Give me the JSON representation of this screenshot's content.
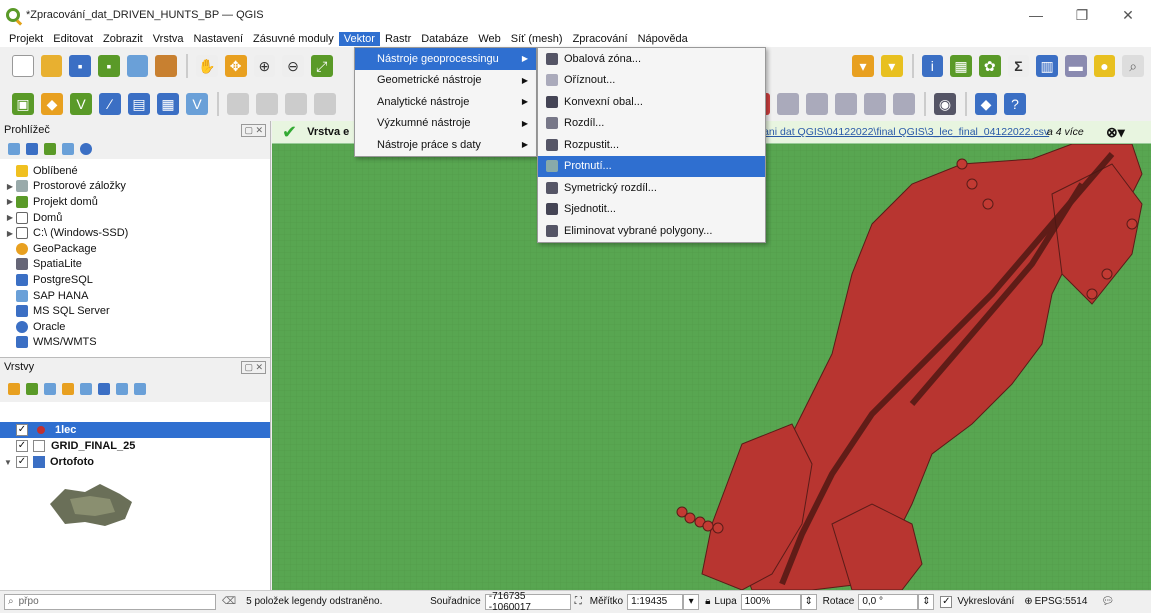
{
  "window": {
    "title": "*Zpracování_dat_DRIVEN_HUNTS_BP — QGIS"
  },
  "menubar": {
    "items": [
      "Projekt",
      "Editovat",
      "Zobrazit",
      "Vrstva",
      "Nastavení",
      "Zásuvné moduly",
      "Vektor",
      "Rastr",
      "Databáze",
      "Web",
      "Síť (mesh)",
      "Zpracování",
      "Nápověda"
    ],
    "active": "Vektor"
  },
  "vector_menu": {
    "items": [
      "Nástroje geoprocessingu",
      "Geometrické nástroje",
      "Analytické nástroje",
      "Výzkumné nástroje",
      "Nástroje práce s daty"
    ],
    "highlighted": "Nástroje geoprocessingu"
  },
  "geoprocessing_menu": {
    "items": [
      "Obalová zóna...",
      "Oříznout...",
      "Konvexní obal...",
      "Rozdíl...",
      "Rozpustit...",
      "Protnutí...",
      "Symetrický rozdíl...",
      "Sjednotit...",
      "Eliminovat vybrané polygony..."
    ],
    "highlighted": "Protnutí..."
  },
  "browser": {
    "title": "Prohlížeč",
    "items": [
      "Oblíbené",
      "Prostorové záložky",
      "Projekt domů",
      "Domů",
      "C:\\ (Windows-SSD)",
      "GeoPackage",
      "SpatiaLite",
      "PostgreSQL",
      "SAP HANA",
      "MS SQL Server",
      "Oracle",
      "WMS/WMTS"
    ]
  },
  "layers": {
    "title": "Vrstvy",
    "items": [
      {
        "name": "1lec",
        "checked": "✓",
        "selected": true
      },
      {
        "name": "GRID_FINAL_25",
        "checked": "✓",
        "selected": false
      },
      {
        "name": "Ortofoto",
        "checked": "✓",
        "selected": false
      }
    ]
  },
  "message_bar": {
    "label": "Vrstva e",
    "path": "ovani dat QGIS\\04122022\\final QGIS\\3_lec_final_04122022.csv",
    "more": "a 4 více"
  },
  "statusbar": {
    "search_placeholder": "přpo",
    "message": "5 položek legendy odstraněno.",
    "coord_label": "Souřadnice",
    "coord_value": "-716735 -1060017",
    "scale_label": "Měřítko",
    "scale_value": "1:19435",
    "magnifier_label": "Lupa",
    "magnifier_value": "100%",
    "rotation_label": "Rotace",
    "rotation_value": "0,0 °",
    "render_label": "Vykreslování",
    "crs": "EPSG:5514"
  },
  "colors": {
    "accent": "#2f6fd0",
    "map_bg": "#58a651",
    "points": "#b83530"
  }
}
